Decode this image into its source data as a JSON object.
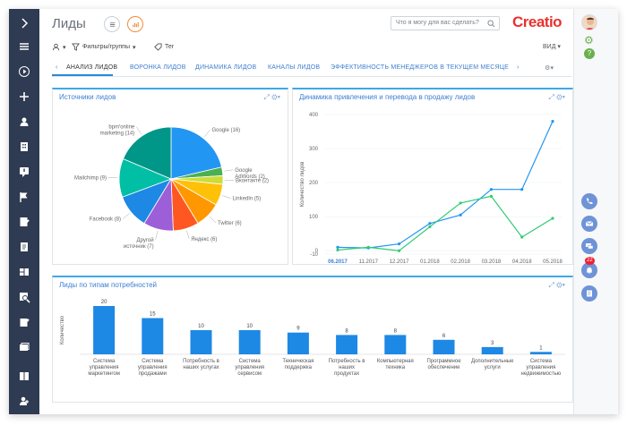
{
  "header": {
    "title": "Лиды",
    "search_placeholder": "Что я могу для вас сделать?",
    "logo": "Creatio",
    "view_label": "ВИД"
  },
  "toolbar": {
    "filters_label": "Фильтры/группы",
    "tag_label": "Тег"
  },
  "tabs": [
    {
      "label": "АНАЛИЗ ЛИДОВ"
    },
    {
      "label": "ВОРОНКА ЛИДОВ"
    },
    {
      "label": "ДИНАМИКА ЛИДОВ"
    },
    {
      "label": "КАНАЛЫ ЛИДОВ"
    },
    {
      "label": "ЭФФЕКТИВНОСТЬ МЕНЕДЖЕРОВ В ТЕКУЩЕМ МЕСЯЦЕ"
    }
  ],
  "notifications_count": "22",
  "colors": {
    "accent": "#3da8e8",
    "brand": "#e8312e",
    "nav": "#2f3b52"
  },
  "chart_data": [
    {
      "type": "pie",
      "title": "Источники лидов",
      "slices": [
        {
          "label": "Google",
          "value": 16,
          "color": "#2196f3"
        },
        {
          "label": "Google AdWords",
          "value": 2,
          "color": "#4caf50"
        },
        {
          "label": "Вконтакте",
          "value": 2,
          "color": "#cddc39"
        },
        {
          "label": "LinkedIn",
          "value": 5,
          "color": "#ffc107"
        },
        {
          "label": "Twitter",
          "value": 6,
          "color": "#ff9800"
        },
        {
          "label": "Яндекс",
          "value": 6,
          "color": "#ff5722"
        },
        {
          "label": "Другой источник",
          "value": 7,
          "color": "#9c5fd8"
        },
        {
          "label": "Facebook",
          "value": 8,
          "color": "#1e88e5"
        },
        {
          "label": "Mailchimp",
          "value": 9,
          "color": "#00bfa5"
        },
        {
          "label": "bpm'online marketing",
          "value": 14,
          "color": "#009688"
        }
      ]
    },
    {
      "type": "line",
      "title": "Динамика привлечения и перевода в продажу лидов",
      "ylabel": "Количество лидов",
      "categories": [
        "06.2017",
        "11.2017",
        "12.2017",
        "01.2018",
        "02.2018",
        "03.2018",
        "04.2018",
        "05.2018"
      ],
      "ylim": [
        -10,
        400
      ],
      "yticks": [
        400,
        300,
        200,
        100,
        0,
        -10
      ],
      "series": [
        {
          "values": [
            10,
            8,
            20,
            80,
            105,
            180,
            180,
            380
          ],
          "color": "#2196f3"
        },
        {
          "values": [
            2,
            10,
            0,
            70,
            140,
            160,
            40,
            95
          ],
          "color": "#2ecc71"
        }
      ]
    },
    {
      "type": "bar",
      "title": "Лиды по типам потребностей",
      "ylabel": "Количество",
      "categories": [
        "Система управления маркетингом",
        "Система управления продажами",
        "Потребность в наших услугах",
        "Система управления сервисом",
        "Техническая поддержка",
        "Потребность в наших продуктах",
        "Компьютерная техника",
        "Программное обеспечение",
        "Дополнительные услуги",
        "Система управления недвижимостью"
      ],
      "values": [
        20,
        15,
        10,
        10,
        9,
        8,
        8,
        6,
        3,
        1
      ],
      "color": "#1e88e5"
    }
  ]
}
